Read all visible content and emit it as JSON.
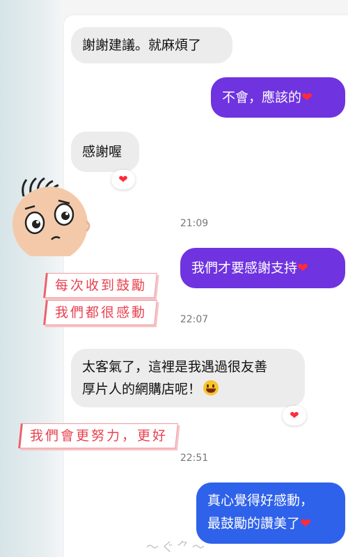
{
  "messages": [
    {
      "text": "謝謝建議。就麻煩了"
    },
    {
      "text": "不會，應該的",
      "suffix_icon": "heart"
    },
    {
      "text": "感謝喔",
      "reaction": "heart"
    },
    {
      "text": "我們才要感謝支持",
      "suffix_icon": "heart"
    },
    {
      "line1": "太客氣了，這裡是我遇過很友善",
      "line2": "厚片人的網購店呢！",
      "suffix_icon": "grinning-emoji",
      "reaction": "heart"
    },
    {
      "line1": "真心覺得好感動，",
      "line2": "最鼓勵的讚美了",
      "suffix_icon": "heart"
    }
  ],
  "timestamps": [
    "21:09",
    "22:07",
    "22:51"
  ],
  "captions": [
    "每次收到鼓勵",
    "我們都很感動",
    "我們會更努力，更好"
  ],
  "colors": {
    "outgoing_purple": "#6f33e0",
    "outgoing_blue": "#2f62ea",
    "incoming": "#ececec",
    "caption_red": "#e8424f",
    "heart": "#ff2a3a"
  },
  "mascot": {
    "icon": "crying-face-mascot-icon"
  }
}
